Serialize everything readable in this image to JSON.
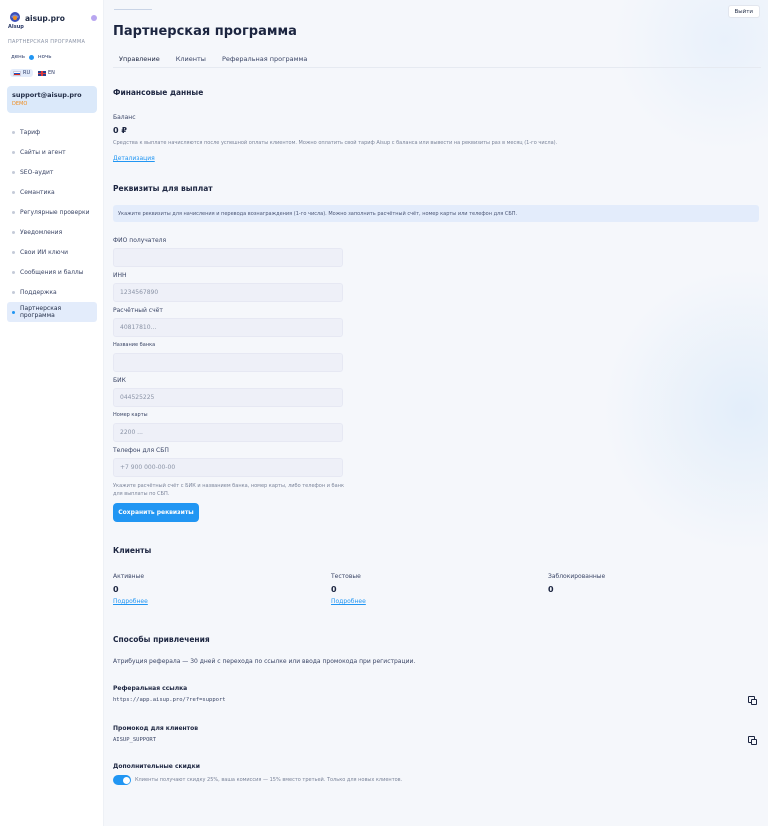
{
  "sidebar": {
    "brand": "aisup.pro",
    "logo_sub": "AIsup",
    "section_caption": "ПАРТНЕРСКАЯ ПРОГРАММА",
    "theme": {
      "day": "день",
      "night": "ночь"
    },
    "languages": [
      "RU",
      "EN"
    ],
    "account": {
      "email": "support@aisup.pro",
      "tier": "DEMO"
    },
    "items": [
      {
        "label": "Тариф"
      },
      {
        "label": "Сайты и агент"
      },
      {
        "label": "SEO-аудит"
      },
      {
        "label": "Семантика"
      },
      {
        "label": "Регулярные проверки"
      },
      {
        "label": "Уведомления"
      },
      {
        "label": "Свои ИИ ключи"
      },
      {
        "label": "Сообщения и баллы"
      },
      {
        "label": "Поддержка"
      },
      {
        "label": "Партнерская программа"
      }
    ],
    "accent": "#2196f3"
  },
  "header": {
    "logout_label": "Выйти"
  },
  "page": {
    "title": "Партнерская программа",
    "tabs": [
      {
        "label": "Управление"
      },
      {
        "label": "Клиенты"
      },
      {
        "label": "Реферальная программа"
      }
    ]
  },
  "finance": {
    "heading": "Финансовые данные",
    "balance_label": "Баланс",
    "balance_value": "0 ₽",
    "note": "Средства к выплате начисляются после успешной оплаты клиентом. Можно оплатить свой тариф Aisup с баланса или вывести на реквизиты раз в месяц (1-го числа).",
    "details_link": "Детализация"
  },
  "requisites": {
    "heading": "Реквизиты для выплат",
    "info": "Укажите реквизиты для начисления и перевода вознаграждения (1-го числа). Можно заполнить расчётный счёт, номер карты или телефон для СБП.",
    "fields": [
      {
        "label": "ФИО получателя",
        "placeholder": ""
      },
      {
        "label": "ИНН",
        "placeholder": "1234567890"
      },
      {
        "label": "Расчётный счёт",
        "placeholder": "40817810..."
      },
      {
        "label": "Название банка",
        "placeholder": ""
      },
      {
        "label": "БИК",
        "placeholder": "044525225"
      },
      {
        "label": "Номер карты",
        "placeholder": "2200 ..."
      },
      {
        "label": "Телефон для СБП",
        "placeholder": "+7 900 000-00-00"
      }
    ],
    "hint": "Укажите расчётный счёт с БИК и названием банка, номер карты, либо телефон и банк для выплаты по СБП.",
    "save_label": "Сохранить реквизиты"
  },
  "clients": {
    "heading": "Клиенты",
    "stats": [
      {
        "label": "Активные",
        "value": "0",
        "link": "Подробнее"
      },
      {
        "label": "Тестовые",
        "value": "0",
        "link": "Подробнее"
      },
      {
        "label": "Заблокированные",
        "value": "0",
        "link": ""
      }
    ]
  },
  "methods": {
    "heading": "Способы привлечения",
    "attribution": "Атрибуция реферала — 30 дней с перехода по ссылке или ввода промокода при регистрации.",
    "ref_link_label": "Реферальная ссылка",
    "ref_link_value": "https://app.aisup.pro/?ref=support",
    "promo_label": "Промокод для клиентов",
    "promo_value": "AISUP_SUPPORT",
    "discount_label": "Дополнительные скидки",
    "discount_text": "Клиенты получают скидку 25%, ваша комиссия — 15% вместо третьей. Только для новых клиентов.",
    "discount_enabled": true
  }
}
